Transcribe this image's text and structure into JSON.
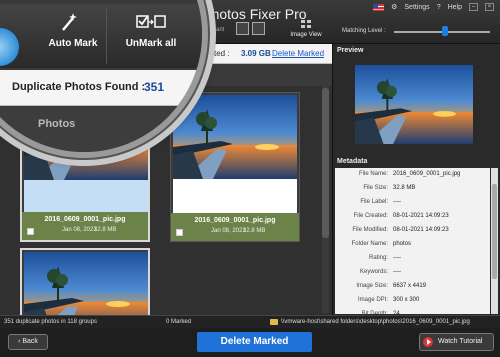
{
  "app": {
    "title": "Duplicate Photos Fixer Pro"
  },
  "top_right": {
    "settings": "Settings",
    "help": "Help"
  },
  "toolbar": {
    "auto_mark": "Auto Mark",
    "unmark_all": "UnMark all",
    "assistant": "ssistant",
    "image_view": "Image View",
    "matching_level": "Matching Level :"
  },
  "summary": {
    "duplicates_label": "Duplicate Photos Found :",
    "duplicates_count": "351",
    "size_label": "ted :",
    "size_value": "3.09 GB",
    "delete_marked_link": "Delete Marked"
  },
  "group": {
    "label": "Photos"
  },
  "photos": [
    {
      "name": "2016_0609_0001_pic.jpg",
      "date": "Jan 08, 2021",
      "size": "32.8 MB"
    },
    {
      "name": "2016_0609_0001_pic.jpg",
      "date": "Jan 08, 2021",
      "size": "32.8 MB"
    }
  ],
  "panel": {
    "preview_title": "Preview",
    "metadata_title": "Metadata",
    "metadata": [
      {
        "key": "File Name:",
        "value": "2016_0609_0001_pic.jpg"
      },
      {
        "key": "File Size:",
        "value": "32.8 MB"
      },
      {
        "key": "File Label:",
        "value": "----"
      },
      {
        "key": "File Created:",
        "value": "08-01-2021 14:09:23"
      },
      {
        "key": "File Modified:",
        "value": "08-01-2021 14:09:23"
      },
      {
        "key": "Folder Name:",
        "value": "photos"
      },
      {
        "key": "Rating:",
        "value": "----"
      },
      {
        "key": "Keywords:",
        "value": "----"
      },
      {
        "key": "Image Size:",
        "value": "6637 x 4419"
      },
      {
        "key": "Image DPI:",
        "value": "300 x 300"
      },
      {
        "key": "Bit Depth:",
        "value": "24"
      },
      {
        "key": "Orientation:",
        "value": "----"
      }
    ]
  },
  "status": {
    "groups": "351 duplicate photos in 118 groups",
    "marked": "0 Marked",
    "path": "\\\\vmware-host\\shared folders\\desktop\\photos\\2016_0609_0001_pic.jpg"
  },
  "bottom": {
    "back": "Back",
    "delete_marked": "Delete Marked",
    "watch_tutorial": "Watch Tutorial"
  },
  "colors": {
    "accent": "#2072d8",
    "count_blue": "#1a4a9c",
    "meta_green": "#6b8248"
  }
}
